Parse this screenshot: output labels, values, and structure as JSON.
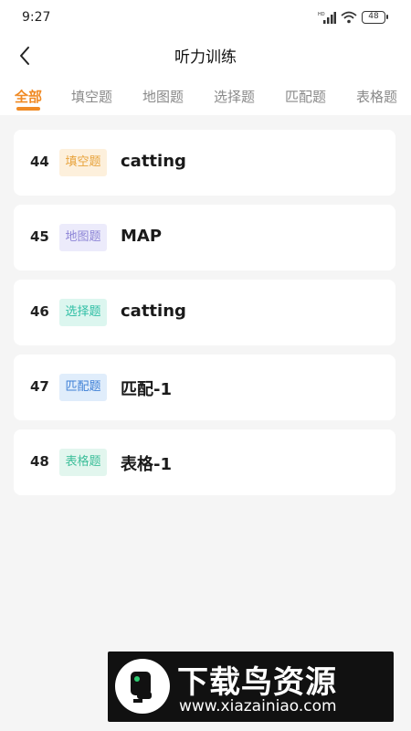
{
  "status_bar": {
    "time": "9:27",
    "battery": "48"
  },
  "header": {
    "title": "听力训练"
  },
  "tabs": [
    {
      "label": "全部",
      "active": true
    },
    {
      "label": "填空题",
      "active": false
    },
    {
      "label": "地图题",
      "active": false
    },
    {
      "label": "选择题",
      "active": false
    },
    {
      "label": "匹配题",
      "active": false
    },
    {
      "label": "表格题",
      "active": false
    }
  ],
  "items": [
    {
      "number": "44",
      "tag": "填空题",
      "tag_color": "#e8a33c",
      "tag_bg": "#fdf0dc",
      "title": "catting"
    },
    {
      "number": "45",
      "tag": "地图题",
      "tag_color": "#8c84d6",
      "tag_bg": "#ecebfb",
      "title": "MAP"
    },
    {
      "number": "46",
      "tag": "选择题",
      "tag_color": "#2fbfa5",
      "tag_bg": "#dcf6ef",
      "title": "catting"
    },
    {
      "number": "47",
      "tag": "匹配题",
      "tag_color": "#3d7fd6",
      "tag_bg": "#e0edfb",
      "title": "匹配-1"
    },
    {
      "number": "48",
      "tag": "表格题",
      "tag_color": "#3dbf9a",
      "tag_bg": "#e2f6ee",
      "title": "表格-1"
    }
  ],
  "colors": {
    "accent": "#f08a24",
    "background": "#f5f5f5"
  },
  "watermark": {
    "brand": "下载鸟资源",
    "url": "www.xiazainiao.com"
  }
}
